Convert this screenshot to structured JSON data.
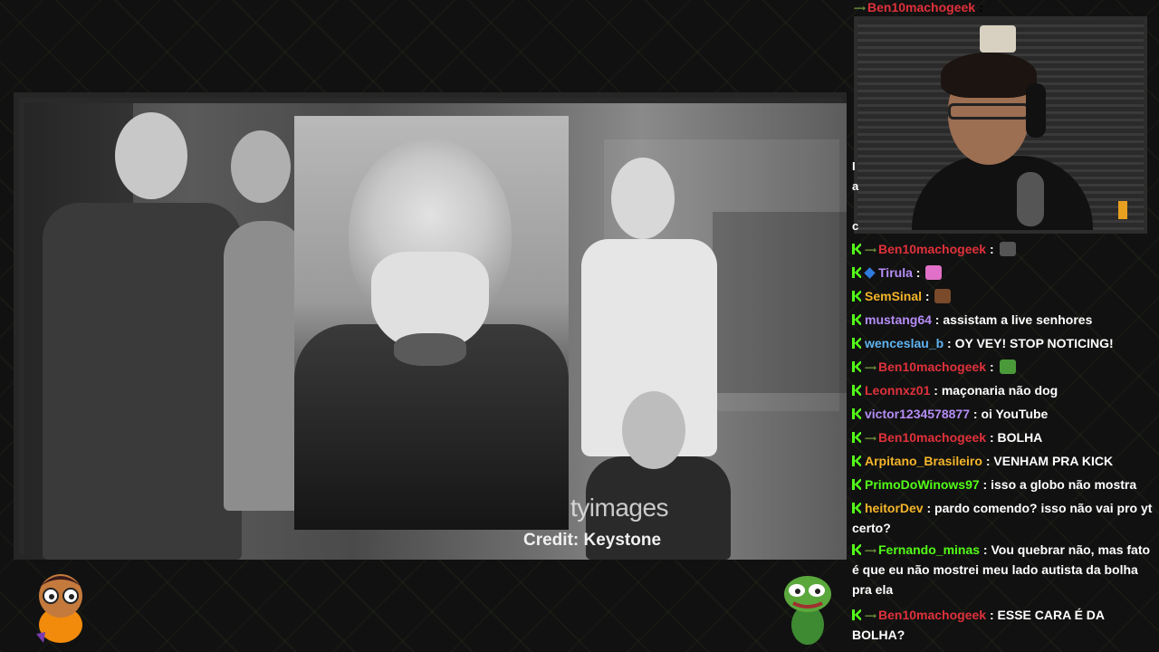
{
  "stream": {
    "watermark": "tyimages",
    "credit": "Credit: Keystone"
  },
  "colors": {
    "kick_green": "#53fc18",
    "chat_bg": "#121212"
  },
  "top_peek": {
    "user": "Ben10machogeek",
    "sep": " :",
    "color": "#e0313b"
  },
  "chat": [
    {
      "badges": [
        "kick",
        "sub"
      ],
      "user": "Ben10machogeek",
      "color": "#e0313b",
      "text": "",
      "emote": "image-emote"
    },
    {
      "badges": [
        "kick",
        "gem"
      ],
      "user": "Tirula",
      "color": "#b58cf5",
      "text": "",
      "emote": "pink-emote"
    },
    {
      "badges": [
        "kick"
      ],
      "user": "SemSinal",
      "color": "#f5b52a",
      "text": "",
      "emote": "brown-emote"
    },
    {
      "badges": [
        "kick"
      ],
      "user": "mustang64",
      "color": "#b58cf5",
      "text": "assistam a live senhores",
      "emote": ""
    },
    {
      "badges": [
        "kick"
      ],
      "user": "wenceslau_b",
      "color": "#60b4f0",
      "text": "OY VEY! STOP NOTICING!",
      "emote": ""
    },
    {
      "badges": [
        "kick",
        "sub"
      ],
      "user": "Ben10machogeek",
      "color": "#e0313b",
      "text": "",
      "emote": "green-emote"
    },
    {
      "badges": [
        "kick"
      ],
      "user": "Leonnxz01",
      "color": "#e0313b",
      "text": "maçonaria não dog",
      "emote": ""
    },
    {
      "badges": [
        "kick"
      ],
      "user": "victor1234578877",
      "color": "#b58cf5",
      "text": "oi YouTube",
      "emote": ""
    },
    {
      "badges": [
        "kick",
        "sub"
      ],
      "user": "Ben10machogeek",
      "color": "#e0313b",
      "text": "BOLHA",
      "emote": ""
    },
    {
      "badges": [
        "kick"
      ],
      "user": "Arpitano_Brasileiro",
      "color": "#f5b52a",
      "text": "VENHAM PRA KICK",
      "emote": ""
    },
    {
      "badges": [
        "kick"
      ],
      "user": "PrimoDoWinows97",
      "color": "#53fc18",
      "text": "isso a globo não mostra",
      "emote": ""
    },
    {
      "badges": [
        "kick"
      ],
      "user": "heitorDev",
      "color": "#f5b52a",
      "text": "pardo comendo? isso não vai pro yt certo?",
      "emote": ""
    },
    {
      "badges": [
        "kick",
        "sub"
      ],
      "user": "Fernando_minas",
      "color": "#53fc18",
      "text": "Vou quebrar não, mas fato é que eu não mostrei meu lado autista da bolha pra ela",
      "emote": ""
    },
    {
      "badges": [
        "kick",
        "sub"
      ],
      "user": "Ben10machogeek",
      "color": "#e0313b",
      "text": "ESSE CARA É DA BOLHA?",
      "emote": ""
    }
  ]
}
